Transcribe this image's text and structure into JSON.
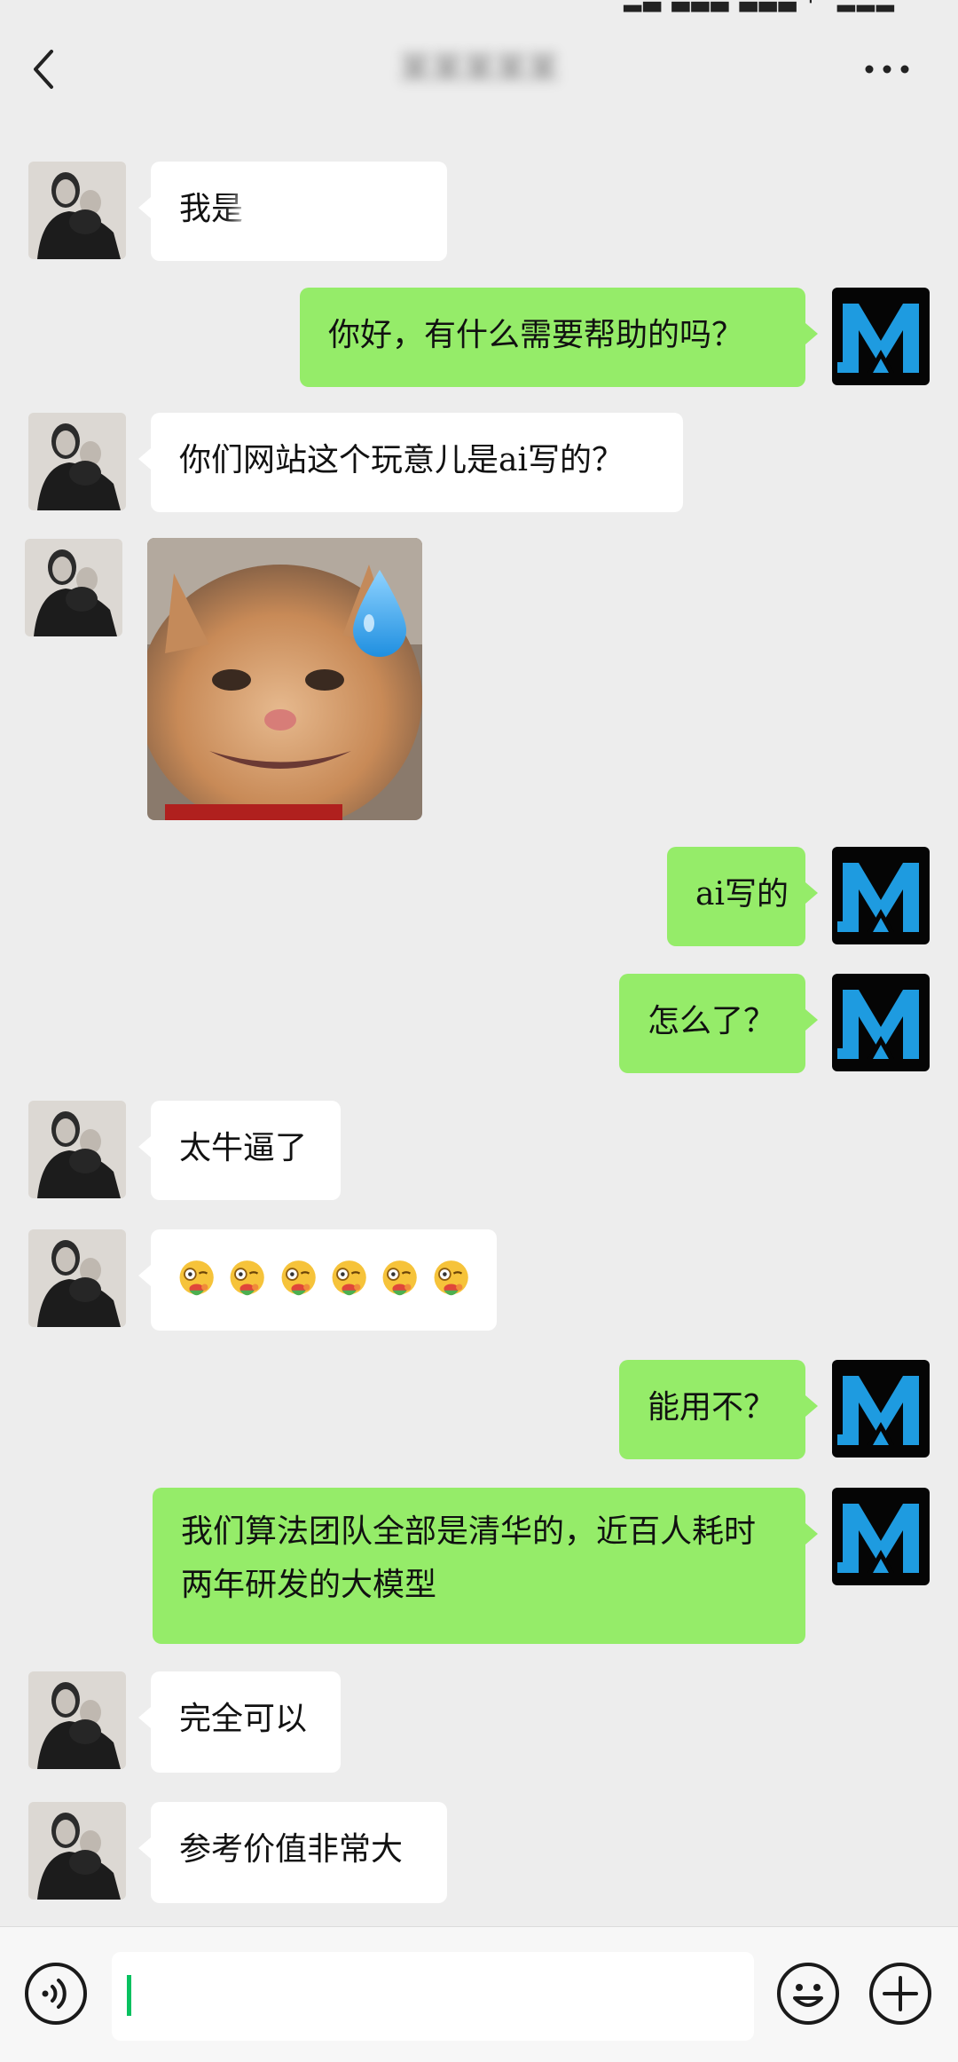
{
  "header": {
    "status_glyphs": "▂▃ ▃▃▃ ▃▃▃ ⌐ ▂▂▂",
    "title": "某某某某某",
    "back_icon": "chevron-left-icon",
    "more_icon": "more-horizontal-icon"
  },
  "messages": {
    "m1": {
      "side": "incoming",
      "text": "我是"
    },
    "m2": {
      "side": "outgoing",
      "text": "你好，有什么需要帮助的吗？"
    },
    "m3": {
      "side": "incoming",
      "text": "你们网站这个玩意儿是ai写的？"
    },
    "m4": {
      "side": "incoming",
      "type": "sticker",
      "sticker": "cat-sweat-sticker"
    },
    "m5": {
      "side": "outgoing",
      "text": "ai写的"
    },
    "m6": {
      "side": "outgoing",
      "text": "怎么了？"
    },
    "m7": {
      "side": "incoming",
      "text": "太牛逼了"
    },
    "m8": {
      "side": "incoming",
      "type": "emoji",
      "emoji": "face-with-monocle-eating-emoji",
      "count": 6
    },
    "m9": {
      "side": "outgoing",
      "text": "能用不？"
    },
    "m10": {
      "side": "outgoing",
      "text": "我们算法团队全部是清华的，近百人耗时两年研发的大模型"
    },
    "m11": {
      "side": "incoming",
      "text": "完全可以"
    },
    "m12": {
      "side": "incoming",
      "text": "参考价值非常大"
    }
  },
  "input_bar": {
    "voice_icon": "voice-icon",
    "input_value": "",
    "emoji_icon": "emoji-icon",
    "plus_icon": "plus-icon"
  },
  "colors": {
    "background": "#ededed",
    "incoming_bubble": "#ffffff",
    "outgoing_bubble": "#95ec69",
    "caret": "#07c160",
    "self_avatar_accent": "#1e9be0"
  }
}
